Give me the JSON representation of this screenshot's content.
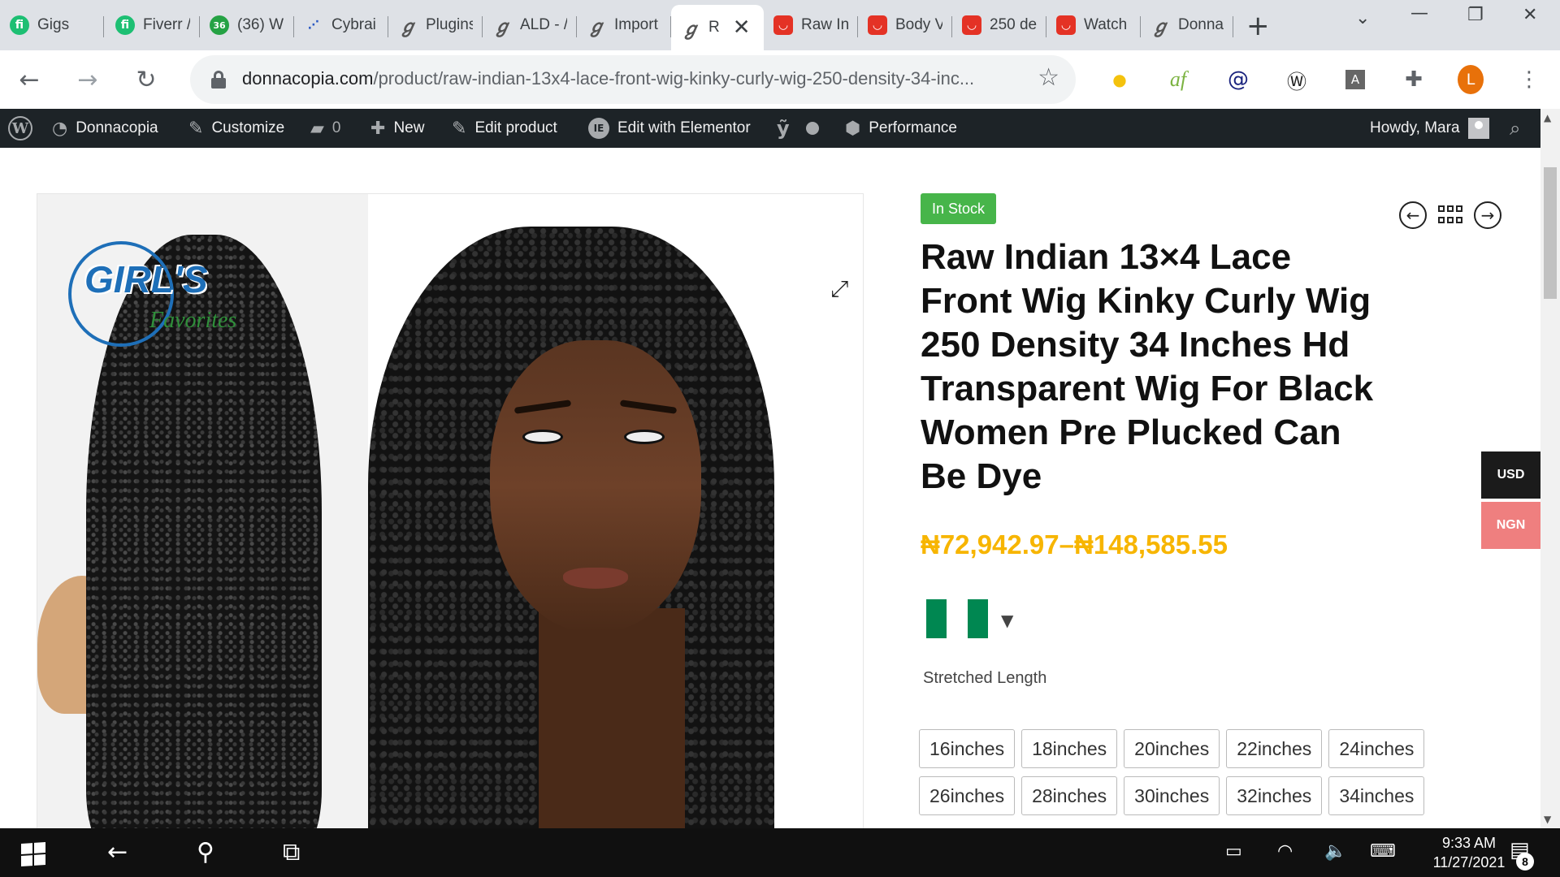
{
  "browser": {
    "tabs": [
      {
        "label": "Gigs",
        "icon": "fiverr-icon"
      },
      {
        "label": "Fiverr /",
        "icon": "fiverr-icon"
      },
      {
        "label": "(36) W",
        "icon": "whatsapp-36-icon"
      },
      {
        "label": "Cybrai",
        "icon": "cybrain-icon"
      },
      {
        "label": "Plugins",
        "icon": "elementor-icon"
      },
      {
        "label": "ALD - /",
        "icon": "elementor-icon"
      },
      {
        "label": "Import",
        "icon": "elementor-icon"
      },
      {
        "label": "R",
        "icon": "elementor-icon",
        "active": true
      },
      {
        "label": "Raw In",
        "icon": "aliexpress-icon"
      },
      {
        "label": "Body V",
        "icon": "aliexpress-icon"
      },
      {
        "label": "250 de",
        "icon": "aliexpress-icon"
      },
      {
        "label": "Watch",
        "icon": "aliexpress-icon"
      },
      {
        "label": "Donna",
        "icon": "elementor-icon"
      }
    ],
    "url_host": "donnacopia.com",
    "url_path": "/product/raw-indian-13x4-lace-front-wig-kinky-curly-wig-250-density-34-inc...",
    "profile_initial": "L"
  },
  "admin_bar": {
    "site": "Donnacopia",
    "customize": "Customize",
    "comments_count": "0",
    "new": "New",
    "edit_product": "Edit product",
    "edit_elementor": "Edit with Elementor",
    "performance": "Performance",
    "howdy": "Howdy, Mara"
  },
  "product": {
    "stock": "In Stock",
    "title": "Raw Indian 13×4 Lace Front Wig Kinky Curly Wig 250 Density 34 Inches Hd Transparent Wig For Black Women Pre Plucked Can Be Dye",
    "price": "₦72,942.97–₦148,585.55",
    "attribute_label": "Stretched Length",
    "lengths": [
      "16inches",
      "18inches",
      "20inches",
      "22inches",
      "24inches",
      "26inches",
      "28inches",
      "30inches",
      "32inches",
      "34inches"
    ],
    "logo_girls": "GIRL'S",
    "logo_favorites": "Favorites",
    "flag_colors": [
      "#008751",
      "#ffffff",
      "#008751"
    ]
  },
  "currency": {
    "usd": "USD",
    "ngn": "NGN"
  },
  "taskbar": {
    "time": "9:33 AM",
    "date": "11/27/2021",
    "notifications": "8"
  },
  "colors": {
    "price": "#f7b500",
    "stock_badge": "#47b54a",
    "ngn_button": "#ef7f7f",
    "admin_bar": "#1d2327"
  }
}
